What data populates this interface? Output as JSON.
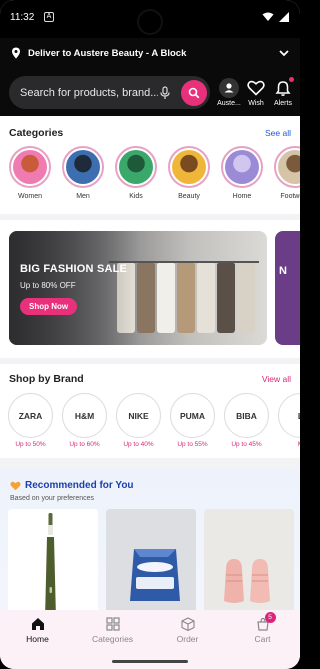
{
  "status_bar": {
    "time": "11:32",
    "notif_glyph": "A"
  },
  "header": {
    "location_text": "Deliver to Austere Beauty - A Block",
    "search_placeholder": "Search for products, brand...",
    "account_label": "Auste...",
    "wishlist_label": "Wish",
    "alerts_label": "Alerts"
  },
  "categories": {
    "title": "Categories",
    "see_all": "See all",
    "items": [
      {
        "label": "Women",
        "colors": [
          "#f07bb0",
          "#c95a3a"
        ]
      },
      {
        "label": "Men",
        "colors": [
          "#3d6fb0",
          "#1f2a3a"
        ]
      },
      {
        "label": "Kids",
        "colors": [
          "#3aa86a",
          "#1e5a3a"
        ]
      },
      {
        "label": "Beauty",
        "colors": [
          "#f0b63a",
          "#7a4a20"
        ]
      },
      {
        "label": "Home",
        "colors": [
          "#9b8ad6",
          "#d0c6ee"
        ]
      },
      {
        "label": "Footwear",
        "colors": [
          "#d6c4a8",
          "#7a5a3a"
        ]
      }
    ]
  },
  "banner": {
    "title": "BIG FASHION SALE",
    "subtitle": "Up to 80% OFF",
    "button_label": "Shop Now",
    "next_banner_letter": "N"
  },
  "brands": {
    "title": "Shop by Brand",
    "view_all": "View all",
    "items": [
      {
        "name": "ZARA",
        "offer": "Up to 50%"
      },
      {
        "name": "H&M",
        "offer": "Up to 60%"
      },
      {
        "name": "NIKE",
        "offer": "Up to 40%"
      },
      {
        "name": "PUMA",
        "offer": "Up to 55%"
      },
      {
        "name": "BIBA",
        "offer": "Up to 45%"
      },
      {
        "name": "L",
        "offer": "M"
      }
    ]
  },
  "recommended": {
    "title": "Recommended for You",
    "subtitle": "Based on your preferences"
  },
  "bottom_nav": {
    "items": [
      {
        "label": "Home"
      },
      {
        "label": "Categories"
      },
      {
        "label": "Order"
      },
      {
        "label": "Cart",
        "badge": "5"
      }
    ]
  },
  "colors": {
    "accent": "#e8317a",
    "link": "#2357d6",
    "header_bg": "#0a0a0a"
  }
}
